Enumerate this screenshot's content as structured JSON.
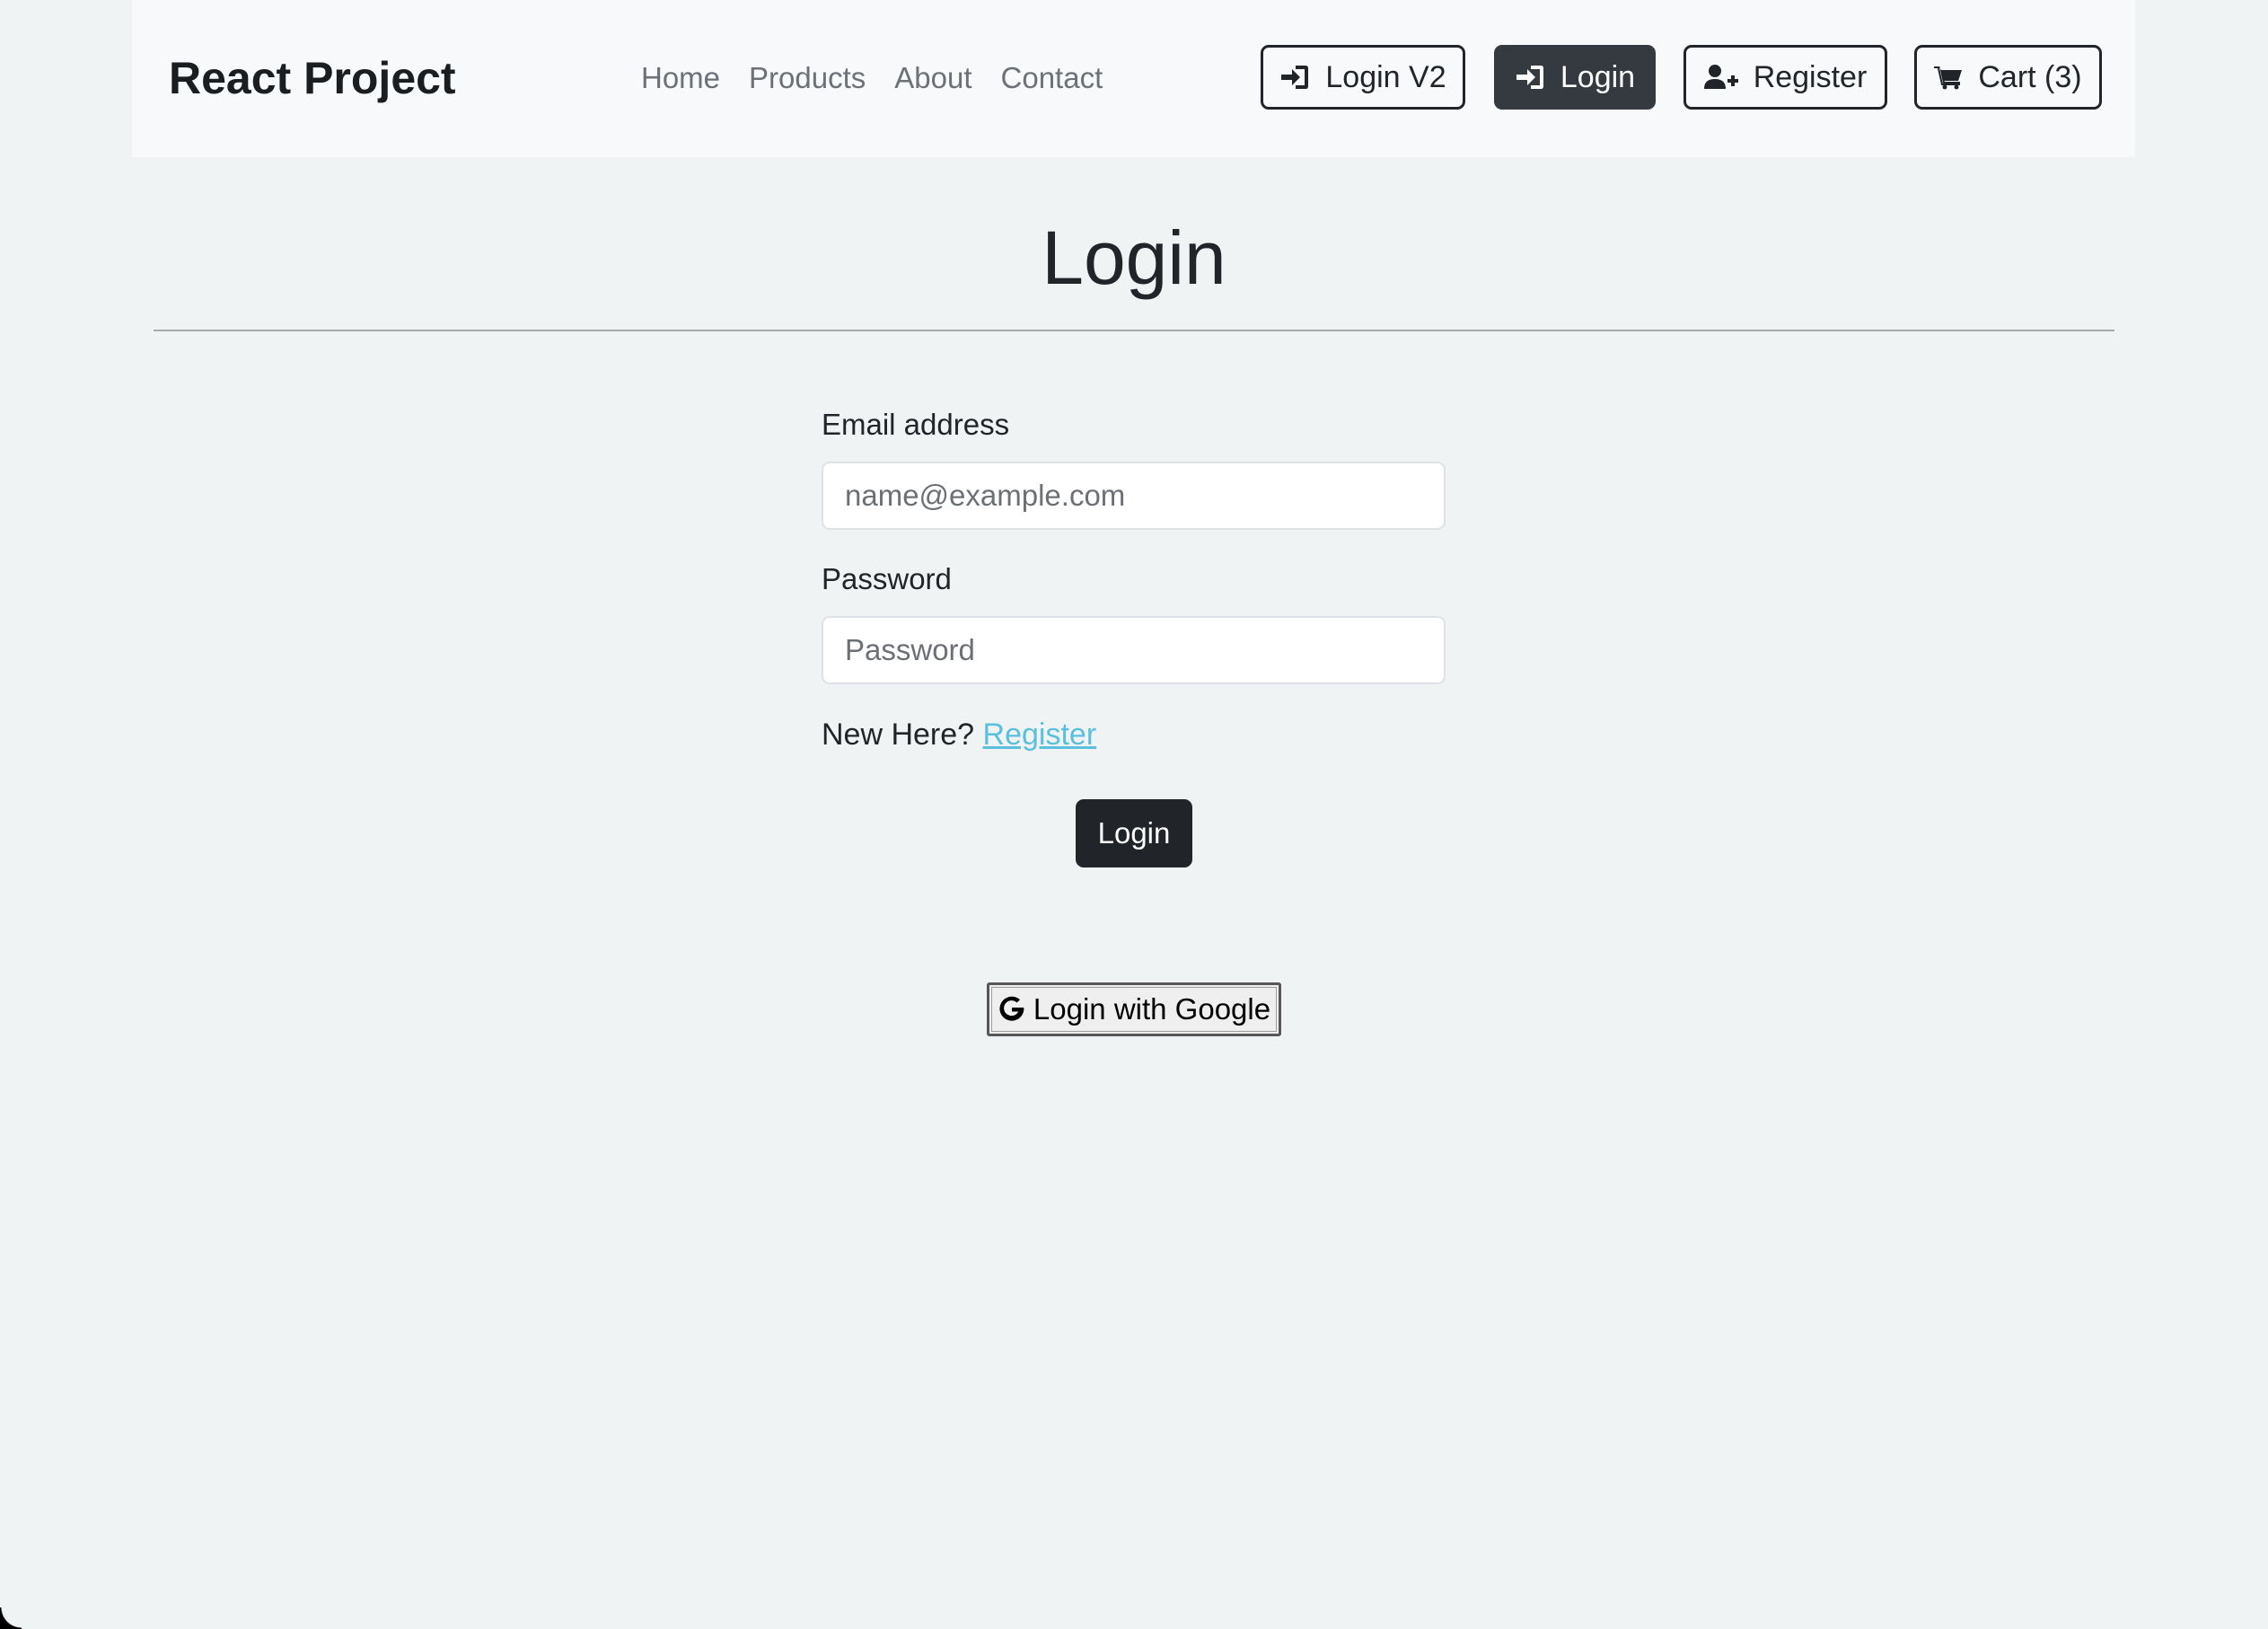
{
  "navbar": {
    "brand": "React Project",
    "links": [
      "Home",
      "Products",
      "About",
      "Contact"
    ],
    "buttons": {
      "login_v2": "Login V2",
      "login": "Login",
      "register": "Register",
      "cart": "Cart (3)"
    },
    "icons": {
      "login_v2": "sign-in-icon",
      "login": "sign-in-icon",
      "register": "user-plus-icon",
      "cart": "shopping-cart-icon"
    }
  },
  "page": {
    "title": "Login"
  },
  "form": {
    "email_label": "Email address",
    "email_placeholder": "name@example.com",
    "email_value": "",
    "password_label": "Password",
    "password_placeholder": "Password",
    "password_value": "",
    "new_here_text": "New Here?",
    "register_link": "Register",
    "submit_label": "Login",
    "google_label": "Login with Google",
    "google_icon": "google-g-icon"
  },
  "colors": {
    "page_background": "#f0f3f3",
    "navbar_background": "#f7f9fa",
    "dark_button": "#343a40",
    "submit_button": "#212529",
    "link": "#5bc0de"
  }
}
